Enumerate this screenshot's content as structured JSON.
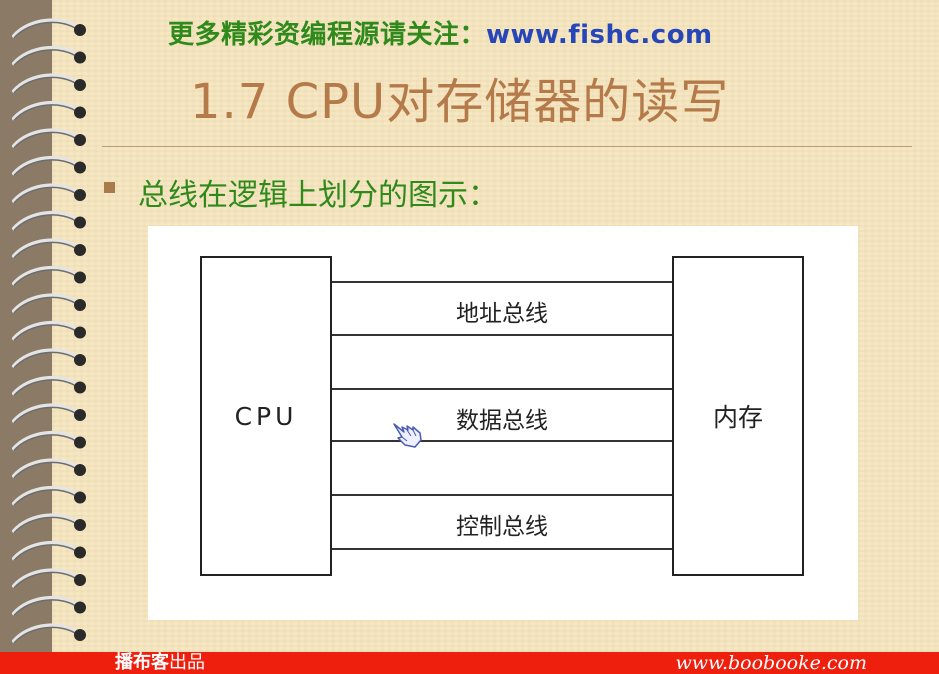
{
  "header": {
    "promo_text": "更多精彩资编程源请关注：",
    "promo_url": "www.fishc.com",
    "title": "1.7 CPU对存储器的读写"
  },
  "content": {
    "bullet": "总线在逻辑上划分的图示："
  },
  "diagram": {
    "left_box": "CPU",
    "right_box": "内存",
    "buses": [
      "地址总线",
      "数据总线",
      "控制总线"
    ]
  },
  "footer": {
    "brand": "播布客",
    "brand_suffix": "出品",
    "url": "www.boobooke.com"
  }
}
